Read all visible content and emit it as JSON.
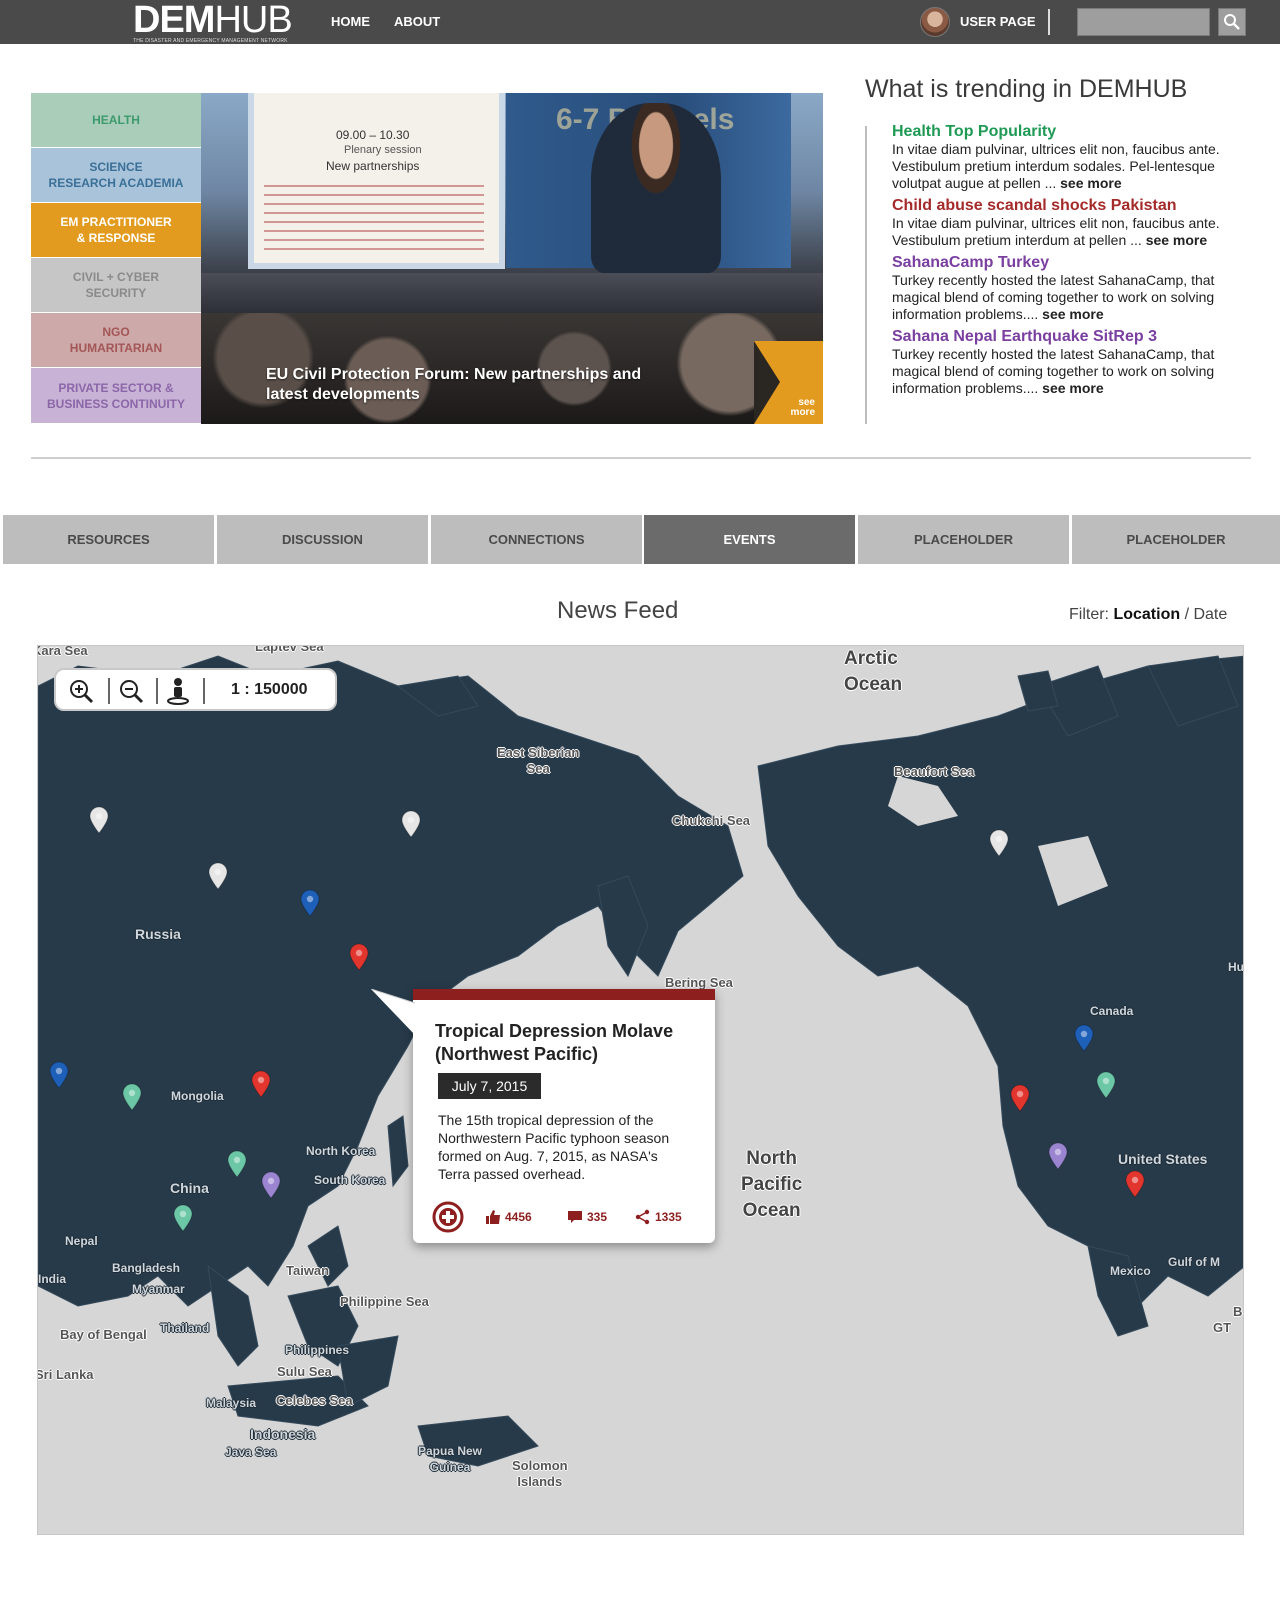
{
  "topbar": {
    "logo_bold": "DEM",
    "logo_light": "HUB",
    "logo_tagline": "THE DISASTER AND EMERGENCY MANAGEMENT NETWORK",
    "nav": [
      "HOME",
      "ABOUT"
    ],
    "user_page": "USER PAGE",
    "search_placeholder": "",
    "search_icon": "search-icon"
  },
  "categories": [
    {
      "label": "HEALTH",
      "bg": "#a9cdb9",
      "color": "#3d9a6c"
    },
    {
      "label": "SCIENCE\nRESEARCH ACADEMIA",
      "bg": "#a9c4da",
      "color": "#3a6f98"
    },
    {
      "label": "EM PRACTITIONER\n& RESPONSE",
      "bg": "#e39b1f",
      "color": "#ffffff"
    },
    {
      "label": "CIVIL + CYBER\nSECURITY",
      "bg": "#c6c6c6",
      "color": "#8a8a8a"
    },
    {
      "label": "NGO\nHUMARITARIAN",
      "bg": "#cda9a9",
      "color": "#a45656"
    },
    {
      "label": "PRIVATE SECTOR &\nBUSINESS CONTINUITY",
      "bg": "#c8b3d6",
      "color": "#8b66a8"
    }
  ],
  "hero": {
    "caption": "EU Civil Protection Forum: New partnerships and latest developments",
    "more": "see\nmore",
    "slide_time": "09.00 – 10.30",
    "slide_sub": "Plenary session",
    "slide_title": "New partnerships",
    "banner": "6-7 Brussels"
  },
  "trending": {
    "title": "What is trending in DEMHUB",
    "items": [
      {
        "headline": "Health Top Popularity",
        "color": "#1f9a55",
        "body": "In vitae diam pulvinar, ultrices elit non, faucibus ante. Vestibulum pretium interdum sodales. Pel-lentesque volutpat augue at pellen ... ",
        "more": "see more"
      },
      {
        "headline": "Child abuse scandal shocks Pakistan",
        "color": "#a52a2a",
        "body": "In vitae diam pulvinar, ultrices elit non, faucibus ante. Vestibulum pretium interdum at pellen ... ",
        "more": "see more"
      },
      {
        "headline": "SahanaCamp Turkey",
        "color": "#7a3fa0",
        "body": "Turkey recently hosted the latest SahanaCamp, that magical blend of coming together to work on solving information problems.... ",
        "more": "see more"
      },
      {
        "headline": "Sahana Nepal Earthquake SitRep 3",
        "color": "#7a3fa0",
        "body": "Turkey recently hosted the latest SahanaCamp, that magical blend of coming together to work on solving information problems.... ",
        "more": "see more"
      }
    ]
  },
  "tabs": [
    {
      "label": "RESOURCES",
      "active": false
    },
    {
      "label": "DISCUSSION",
      "active": false
    },
    {
      "label": "CONNECTIONS",
      "active": false
    },
    {
      "label": "EVENTS",
      "active": true
    },
    {
      "label": "PLACEHOLDER",
      "active": false
    },
    {
      "label": "PLACEHOLDER",
      "active": false
    }
  ],
  "newsfeed": {
    "title": "News Feed",
    "filter_prefix": "Filter:",
    "filter_location": "Location",
    "filter_sep": " / ",
    "filter_date": "Date"
  },
  "map": {
    "scale": "1 : 150000",
    "tools": [
      "zoom-in-icon",
      "zoom-out-icon",
      "street-view-icon"
    ],
    "labels": [
      "Kara Sea",
      "Laptev Sea",
      "Arctic\nOcean",
      "East Siberian\nSea",
      "Beaufort Sea",
      "Chukchi Sea",
      "Russia",
      "Bering Sea",
      "Canada",
      "Mongolia",
      "North Korea",
      "South Korea",
      "China",
      "North\nPacific\nOcean",
      "United States",
      "Nepal",
      "Bangladesh",
      "India",
      "Myanmar",
      "Taiwan",
      "Philippine Sea",
      "Mexico",
      "Gulf of M",
      "Thailand",
      "Bay of Bengal",
      "Philippines",
      "Sri Lanka",
      "Sulu Sea",
      "Malaysia",
      "Celebes Sea",
      "Indonesia",
      "Java Sea",
      "Papua New\nGuinea",
      "Solomon\nIslands",
      "Hu",
      "B",
      "GT"
    ],
    "pin_colors": {
      "white": "#e6e6e6",
      "blue": "#1e5fb8",
      "red": "#e2352e",
      "teal": "#6cc7a7",
      "purple": "#9b85d1"
    }
  },
  "popup": {
    "title": "Tropical Depression Molave (Northwest Pacific)",
    "date": "July 7, 2015",
    "description": "The 15th tropical depression of the Northwestern Pacific typhoon season formed on Aug. 7, 2015, as NASA's Terra passed overhead.",
    "likes": "4456",
    "comments": "335",
    "shares": "1335"
  }
}
